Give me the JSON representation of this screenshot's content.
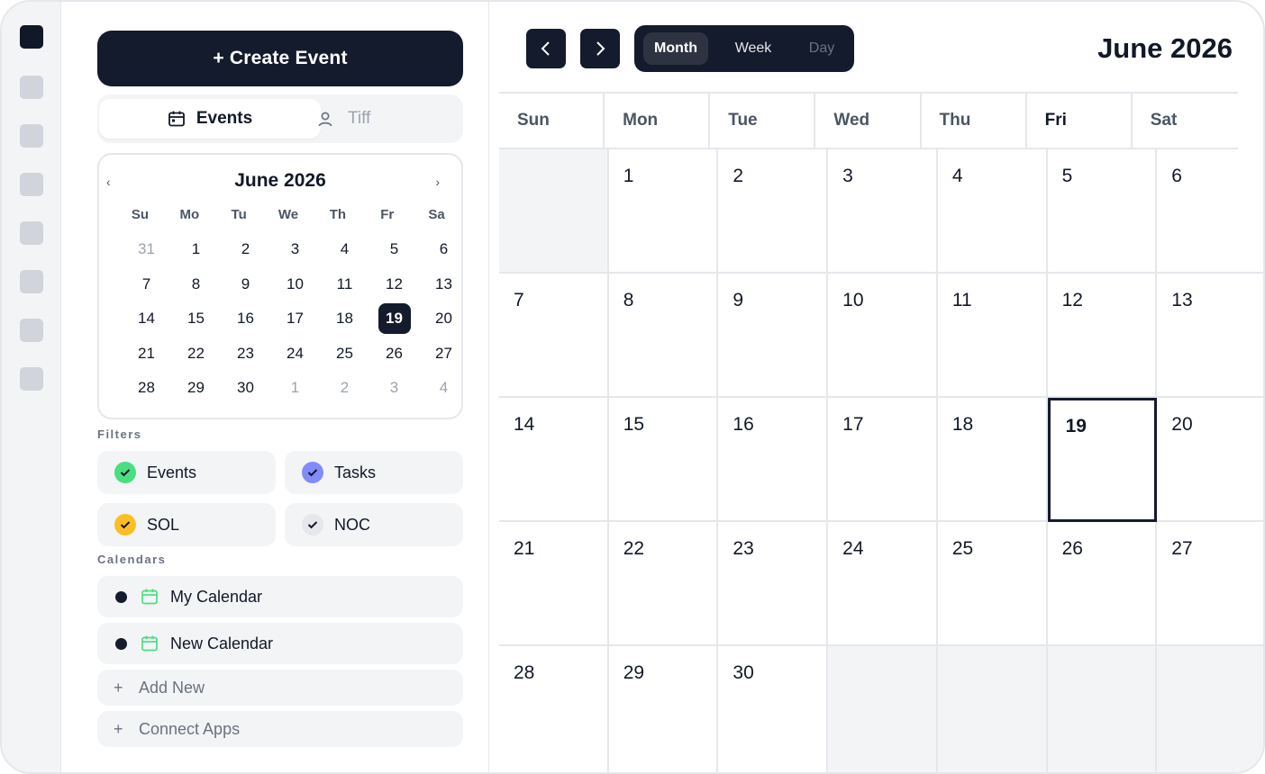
{
  "create_button": "+ Create Event",
  "panel_tabs": {
    "events": "Events",
    "user": "Tiff"
  },
  "mini_calendar": {
    "title": "June 2026",
    "prev": "‹",
    "next": "›",
    "weekdays": [
      "Su",
      "Mo",
      "Tu",
      "We",
      "Th",
      "Fr",
      "Sa"
    ],
    "days": [
      {
        "d": "31",
        "m": true
      },
      {
        "d": "1"
      },
      {
        "d": "2"
      },
      {
        "d": "3"
      },
      {
        "d": "4"
      },
      {
        "d": "5"
      },
      {
        "d": "6"
      },
      {
        "d": "7"
      },
      {
        "d": "8"
      },
      {
        "d": "9"
      },
      {
        "d": "10"
      },
      {
        "d": "11"
      },
      {
        "d": "12"
      },
      {
        "d": "13"
      },
      {
        "d": "14"
      },
      {
        "d": "15"
      },
      {
        "d": "16"
      },
      {
        "d": "17"
      },
      {
        "d": "18"
      },
      {
        "d": "19",
        "today": true
      },
      {
        "d": "20"
      },
      {
        "d": "21"
      },
      {
        "d": "22"
      },
      {
        "d": "23"
      },
      {
        "d": "24"
      },
      {
        "d": "25"
      },
      {
        "d": "26"
      },
      {
        "d": "27"
      },
      {
        "d": "28"
      },
      {
        "d": "29"
      },
      {
        "d": "30"
      },
      {
        "d": "1",
        "m": true
      },
      {
        "d": "2",
        "m": true
      },
      {
        "d": "3",
        "m": true
      },
      {
        "d": "4",
        "m": true
      }
    ]
  },
  "filters": {
    "label": "Filters",
    "items": [
      {
        "label": "Events",
        "color": "#4ade80",
        "check": "#111827"
      },
      {
        "label": "Tasks",
        "color": "#818cf8",
        "check": "#111827"
      },
      {
        "label": "SOL",
        "color": "#fbbf24",
        "check": "#111827"
      },
      {
        "label": "NOC",
        "color": "#e5e7eb",
        "check": "#111827"
      }
    ]
  },
  "calendars": {
    "label": "Calendars",
    "items": [
      {
        "label": "My Calendar",
        "icon_color": "#4ade80"
      },
      {
        "label": "New Calendar",
        "icon_color": "#4ade80"
      }
    ],
    "add_new": "Add New",
    "connect_apps": "Connect Apps",
    "plus": "+"
  },
  "view_tabs": {
    "month": "Month",
    "week": "Week",
    "day": "Day"
  },
  "main_title": "June 2026",
  "weekdays": [
    "Sun",
    "Mon",
    "Tue",
    "Wed",
    "Thu",
    "Fri",
    "Sat"
  ],
  "month_cells": [
    "",
    "1",
    "2",
    "3",
    "4",
    "5",
    "6",
    "7",
    "8",
    "9",
    "10",
    "11",
    "12",
    "13",
    "14",
    "15",
    "16",
    "17",
    "18",
    "19",
    "20",
    "21",
    "22",
    "23",
    "24",
    "25",
    "26",
    "27",
    "28",
    "29",
    "30",
    "",
    "",
    "",
    ""
  ],
  "today": "19",
  "colors": {
    "accent": "#141b2d",
    "border": "#e5e7eb",
    "muted_bg": "#f3f4f6"
  }
}
